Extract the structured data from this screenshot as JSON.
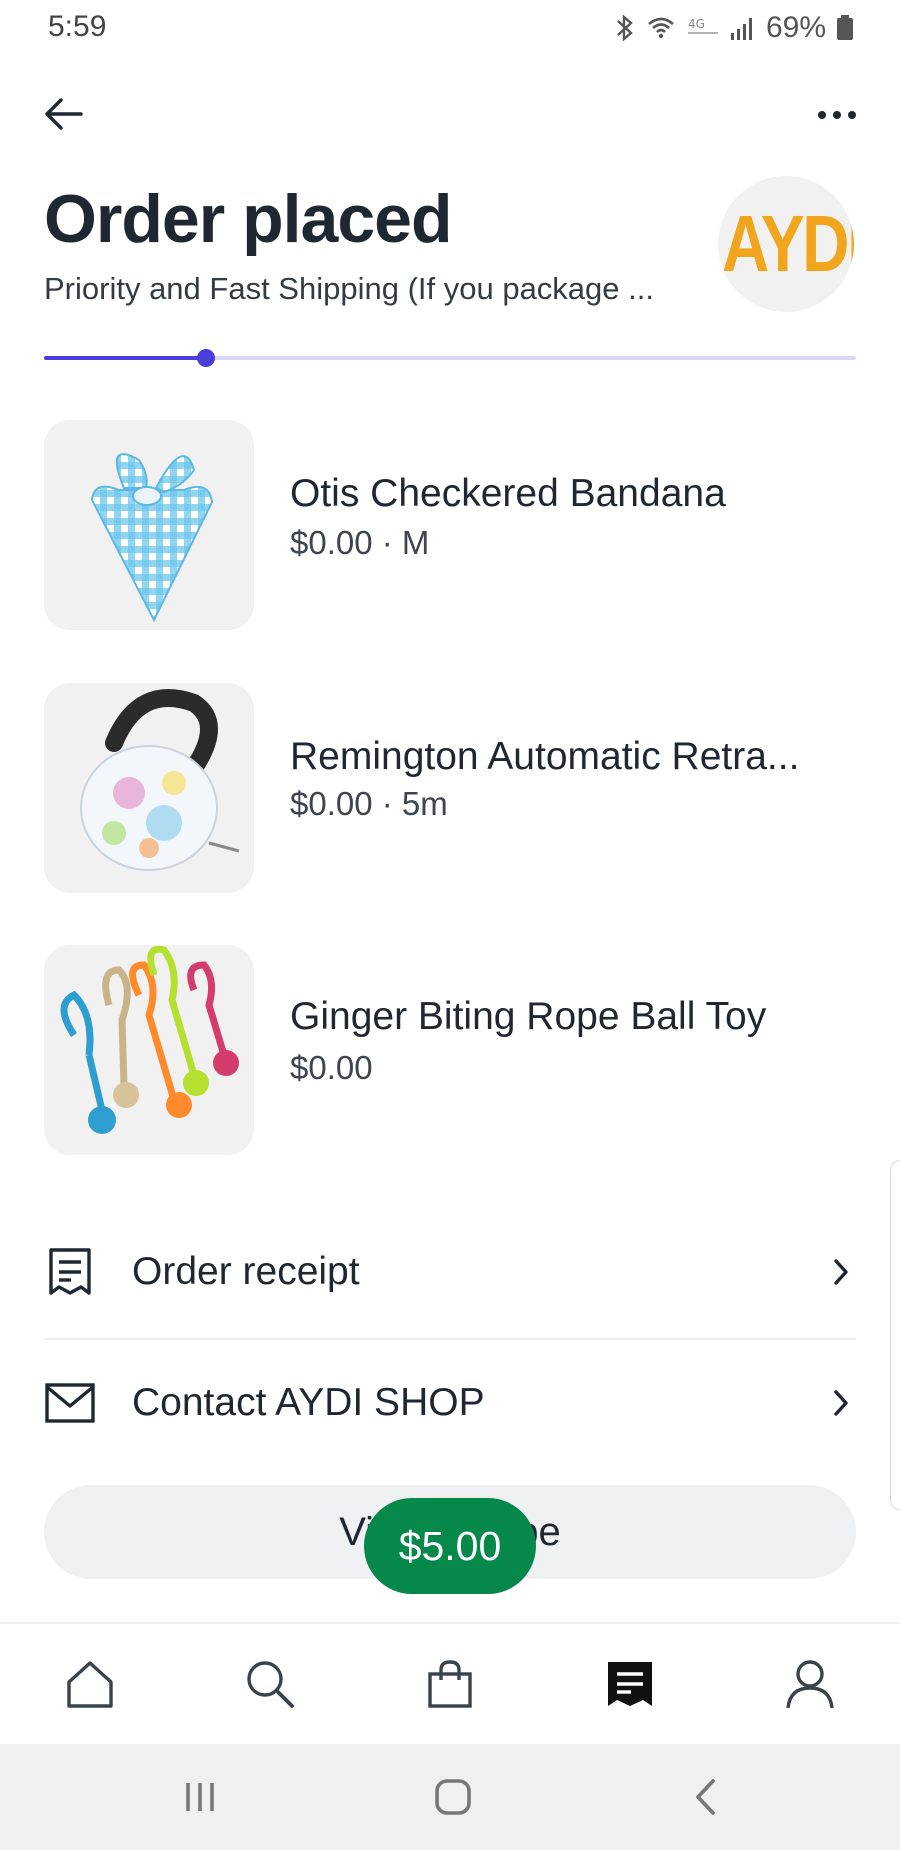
{
  "status_bar": {
    "time": "5:59",
    "battery": "69%",
    "icons": [
      "bluetooth-icon",
      "wifi-icon",
      "lte-icon",
      "signal-icon",
      "battery-icon"
    ]
  },
  "header": {
    "title": "Order placed",
    "subtitle": "Priority and Fast Shipping (If you package ...",
    "shop_logo_text": "AYDI",
    "progress": 0.2
  },
  "items": [
    {
      "name": "Otis Checkered Bandana",
      "meta": "$0.00 · M"
    },
    {
      "name": "Remington Automatic Retra...",
      "meta": "$0.00 · 5m"
    },
    {
      "name": "Ginger Biting Rope Ball Toy",
      "meta": "$0.00"
    }
  ],
  "actions": {
    "receipt_label": "Order receipt",
    "contact_label": "Contact AYDI SHOP"
  },
  "pill": {
    "label": "View Recipe"
  },
  "price_bubble": "$5.00",
  "tabs": [
    "home",
    "search",
    "shop",
    "orders",
    "account"
  ],
  "active_tab": "orders",
  "colors": {
    "accent": "#4b3fdb",
    "accent_light": "#d9d7f7",
    "price_green": "#06884a",
    "logo_orange": "#f0a51d",
    "text": "#1e2732"
  }
}
